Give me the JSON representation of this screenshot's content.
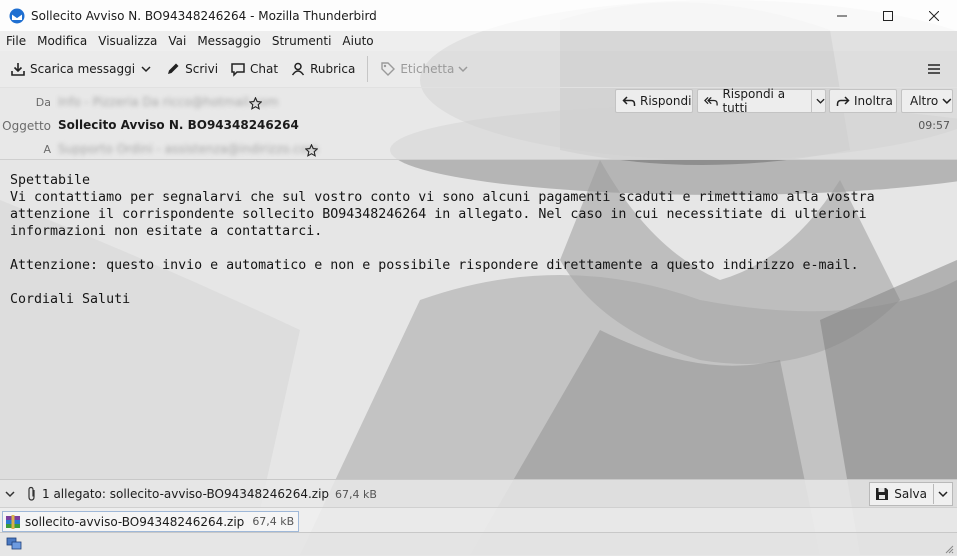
{
  "window": {
    "title": "Sollecito Avviso N. BO94348246264 - Mozilla Thunderbird"
  },
  "menu": [
    "File",
    "Modifica",
    "Visualizza",
    "Vai",
    "Messaggio",
    "Strumenti",
    "Aiuto"
  ],
  "toolbar": {
    "get_messages": "Scarica messaggi",
    "write": "Scrivi",
    "chat": "Chat",
    "address_book": "Rubrica",
    "tag": "Etichetta"
  },
  "header": {
    "from_label": "Da",
    "from_value": "Info - Pizzeria Da ricco@hotmail.com",
    "subject_label": "Oggetto",
    "subject_value": "Sollecito Avviso N. BO94348246264",
    "to_label": "A",
    "to_value": "Supporto Ordini - assistenza@indirizzo.com",
    "time": "09:57",
    "reply": "Rispondi",
    "reply_all": "Rispondi a tutti",
    "forward": "Inoltra",
    "more": "Altro"
  },
  "body": {
    "line1": "Spettabile",
    "line2": "Vi contattiamo per segnalarvi che sul vostro conto vi sono alcuni pagamenti scaduti e rimettiamo alla vostra",
    "line3": "attenzione il corrispondente sollecito BO94348246264 in allegato. Nel caso in cui necessitiate di ulteriori",
    "line4": "informazioni non esitate a contattarci.",
    "line5": "",
    "line6": "Attenzione: questo invio e automatico e non e possibile rispondere direttamente a questo indirizzo e-mail.",
    "line7": "",
    "line8": "Cordiali Saluti"
  },
  "attachments": {
    "summary": "1 allegato: sollecito-avviso-BO94348246264.zip",
    "summary_size": "67,4 kB",
    "save": "Salva",
    "file_name": "sollecito-avviso-BO94348246264.zip",
    "file_size": "67,4 kB"
  },
  "colors": {
    "accent": "#0a84ff",
    "background_image": "grayscale photo of a person wearing a fedora hat"
  }
}
